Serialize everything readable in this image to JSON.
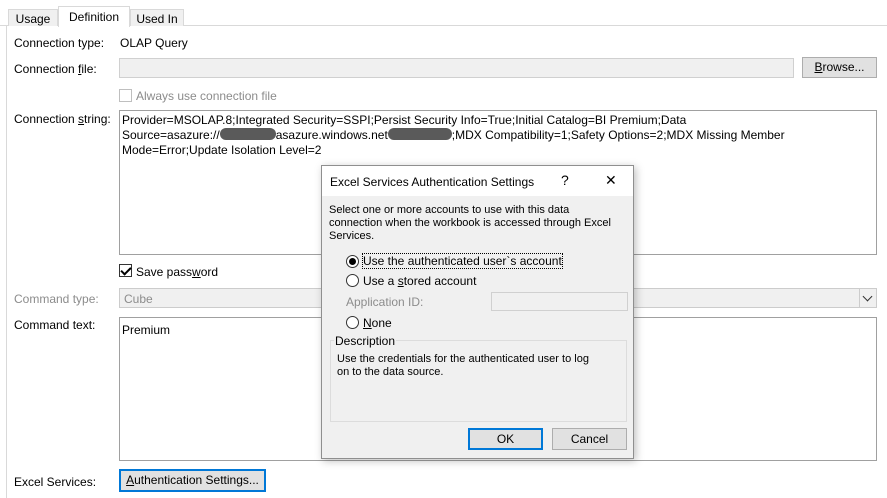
{
  "tabs": {
    "usage": "Usage",
    "definition": "Definition",
    "used_in": "Used In"
  },
  "connection_type": {
    "label": "Connection type:",
    "value": "OLAP Query"
  },
  "connection_file": {
    "label_pre": "Connection ",
    "label_ul": "f",
    "label_post": "ile:",
    "value": "",
    "browse_ul": "B",
    "browse_rest": "rowse..."
  },
  "always_use": {
    "label": "Always use connection file",
    "checked": false
  },
  "connection_string": {
    "label_pre": "Connection ",
    "label_ul": "s",
    "label_post": "tring:",
    "line1": "Provider=MSOLAP.8;Integrated Security=SSPI;Persist Security Info=True;Initial Catalog=BI Premium;Data",
    "line2a": "Source=asazure://",
    "line2b": "asazure.windows.net",
    "line2c": ";MDX Compatibility=1;Safety Options=2;MDX Missing Member",
    "line3": "Mode=Error;Update Isolation Level=2"
  },
  "save_password": {
    "label_pre": "Save pass",
    "label_ul": "w",
    "label_post": "ord",
    "checked": true
  },
  "command_type": {
    "label": "Command type:",
    "value": "Cube"
  },
  "command_text": {
    "label": "Command text:",
    "value": "Premium"
  },
  "excel_services": {
    "label": "Excel Services:",
    "button_ul": "A",
    "button_rest": "uthentication Settings..."
  },
  "dialog": {
    "title": "Excel Services Authentication Settings",
    "help": "?",
    "close": "✕",
    "intro_1": "Select one or more accounts to use with this data",
    "intro_2": "connection when the workbook is accessed through Excel",
    "intro_3": "Services.",
    "options": {
      "authenticated_user": "Use the authenticated user`s account",
      "stored_account_pre": "Use a ",
      "stored_account_ul": "s",
      "stored_account_post": "tored account",
      "none_ul": "N",
      "none_post": "one"
    },
    "selected": "authenticated_user",
    "app_id_label": "Application ID:",
    "app_id_value": "",
    "description_label": "Description",
    "description_1": "Use the credentials for the authenticated user to log",
    "description_2": "on to the data source.",
    "ok": "OK",
    "cancel": "Cancel"
  }
}
